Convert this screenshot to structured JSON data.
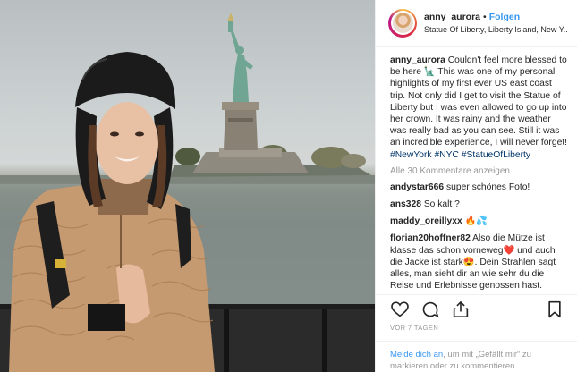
{
  "header": {
    "username": "anny_aurora",
    "separator": "•",
    "follow_label": "Folgen",
    "location": "Statue Of Liberty, Liberty Island, New Y..."
  },
  "post": {
    "caption_author": "anny_aurora",
    "caption_text": "Couldn't feel more blessed to be here 🗽 This was one of my personal highlights of my first ever US east coast trip. Not only did I get to visit the Statue of Liberty but I was even allowed to go up into her crown. It was rainy and the weather was really bad as you can see. Still it was an incredible experience, I will never forget!",
    "hashtags": [
      "#NewYork",
      "#NYC",
      "#StatueOfLiberty"
    ],
    "view_all_comments": "Alle 30 Kommentare anzeigen",
    "comments": [
      {
        "user": "andystar666",
        "text": "super schönes Foto!"
      },
      {
        "user": "ans328",
        "text": "So kalt ?"
      },
      {
        "user": "maddy_oreillyxx",
        "text": "🔥💦"
      },
      {
        "user": "florian20hoffner82",
        "text": "Also die Mütze ist klasse das schon vorneweg❤️ und auch die Jacke ist stark😍. Dein Strahlen sagt alles, man sieht dir an wie sehr du die Reise und Erlebnisse genossen hast."
      }
    ],
    "date": "VOR 7 TAGEN"
  },
  "actions": {
    "icons": [
      "heart-icon",
      "comment-icon",
      "share-icon",
      "bookmark-icon"
    ]
  },
  "login_prompt": {
    "link": "Melde dich an",
    "text": ", um mit „Gefällt mir“ zu markieren oder zu kommentieren."
  },
  "colors": {
    "link_blue": "#3897f0",
    "hashtag_blue": "#003569",
    "muted_gray": "#999999",
    "jacket_tan": "#c69a70",
    "hat_black": "#1b1b1b",
    "statue_green": "#6fa592"
  }
}
